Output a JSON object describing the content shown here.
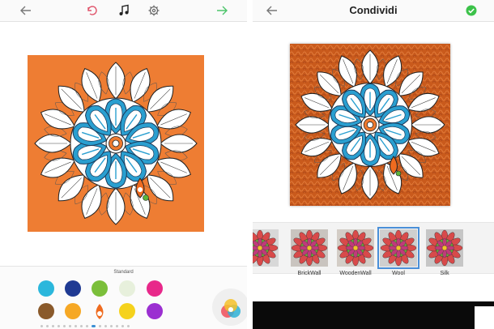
{
  "editor": {
    "palette_label": "Standard",
    "palette": [
      "#2bb7dc",
      "#1f3a93",
      "#7bbf3a",
      "#e7f0dc",
      "#e8288a",
      "#8a5a2b",
      "#f6a825",
      "#ef6b1f",
      "#f5d21c",
      "#9b2fd1"
    ],
    "selected_color_index": 7,
    "page_count": 16,
    "active_page": 9,
    "accent": "#3b8fd4",
    "canvas_color": "#ee7d33"
  },
  "share": {
    "title": "Condividi",
    "filters": [
      {
        "label": "",
        "texture": "#d8d8d8"
      },
      {
        "label": "BrickWall",
        "texture": "#c9c4bf"
      },
      {
        "label": "WoodenWall",
        "texture": "#d3cdc6"
      },
      {
        "label": "Wool",
        "texture": "#cfcfcf"
      },
      {
        "label": "Silk",
        "texture": "#c6c6c6"
      }
    ],
    "selected_filter_index": 3,
    "confirm_color": "#3cc24a"
  }
}
